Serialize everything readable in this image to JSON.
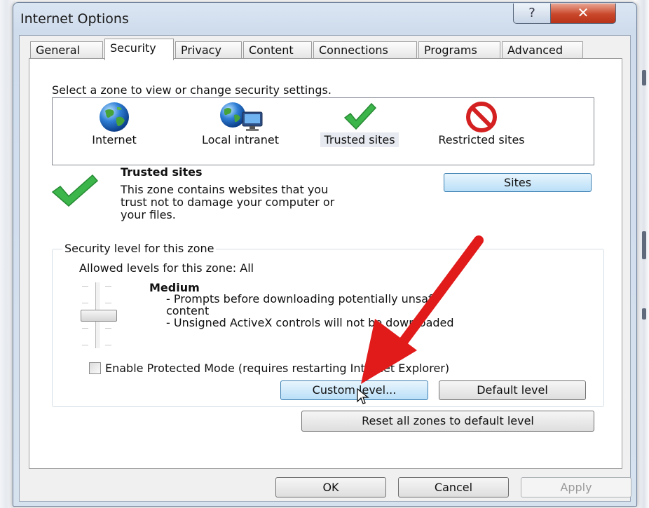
{
  "window": {
    "title": "Internet Options",
    "help_glyph": "?",
    "close_glyph": "✕"
  },
  "tabs": [
    {
      "label": "General"
    },
    {
      "label": "Security",
      "active": true
    },
    {
      "label": "Privacy"
    },
    {
      "label": "Content"
    },
    {
      "label": "Connections"
    },
    {
      "label": "Programs"
    },
    {
      "label": "Advanced"
    }
  ],
  "zones": {
    "prompt": "Select a zone to view or change security settings.",
    "items": [
      {
        "label": "Internet",
        "icon": "globe-icon"
      },
      {
        "label": "Local intranet",
        "icon": "intranet-globe-icon"
      },
      {
        "label": "Trusted sites",
        "icon": "checkmark-icon",
        "selected": true
      },
      {
        "label": "Restricted sites",
        "icon": "no-entry-icon"
      }
    ]
  },
  "selected_zone": {
    "title": "Trusted sites",
    "description_lines": [
      "This zone contains websites that you",
      "trust not to damage your computer or",
      "your files."
    ],
    "sites_button": "Sites"
  },
  "security_level": {
    "group_label": "Security level for this zone",
    "allowed_levels": "Allowed levels for this zone: All",
    "level_name": "Medium",
    "level_lines": [
      "- Prompts before downloading potentially unsafe",
      "content",
      "- Unsigned ActiveX controls will not be downloaded"
    ],
    "slider_level": "Medium",
    "protected_mode_label": "Enable Protected Mode (requires restarting Internet Explorer)",
    "protected_mode_checked": false,
    "custom_level_button": "Custom level...",
    "default_level_button": "Default level"
  },
  "reset_button": "Reset all zones to default level",
  "footer": {
    "ok": "OK",
    "cancel": "Cancel",
    "apply": "Apply"
  },
  "colors": {
    "accent_button": "#b9dff8",
    "close_button": "#c9472b",
    "annotation_arrow": "#e11a1a",
    "check_green": "#39b54a",
    "restricted_red": "#d42020"
  }
}
